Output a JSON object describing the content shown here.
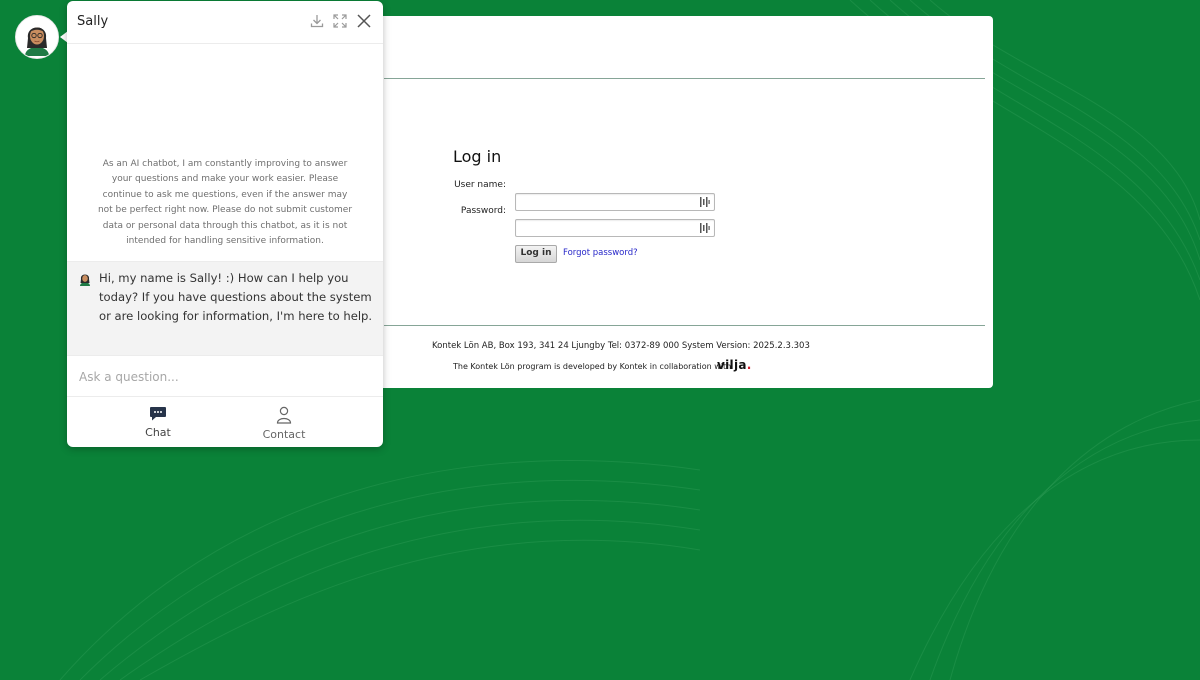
{
  "chatbot": {
    "name": "Sally",
    "disclaimer": "As an AI chatbot, I am constantly improving to answer your questions and make your work easier. Please continue to ask me questions, even if the answer may not be perfect right now. Please do not submit customer data or personal data through this chatbot, as it is not intended for handling sensitive information.",
    "greeting": "Hi, my name is Sally! :) How can I help you today? If you have questions about the system or are looking for information, I'm here to help.",
    "input_placeholder": "Ask a question...",
    "tabs": [
      {
        "label": "Chat",
        "icon": "chat-bubble-icon"
      },
      {
        "label": "Contact",
        "icon": "person-icon"
      }
    ],
    "header_icons": [
      "download-icon",
      "expand-icon",
      "close-icon"
    ]
  },
  "login": {
    "title": "Log in",
    "username_label": "User name:",
    "password_label": "Password:",
    "username_value": "",
    "password_value": "",
    "login_button": "Log in",
    "forgot_link": "Forgot password?"
  },
  "footer": {
    "company_line": "Kontek Lön AB, Box 193, 341 24 Ljungby Tel: 0372-89 000 System Version: 2025.2.3.303",
    "collab_line": "The Kontek Lön program is developed by Kontek in collaboration with",
    "partner_logo": "vilja",
    "partner_logo_dot": "."
  },
  "colors": {
    "background": "#0a8238",
    "link": "#2727c9",
    "partner_dot": "#d6202f"
  }
}
